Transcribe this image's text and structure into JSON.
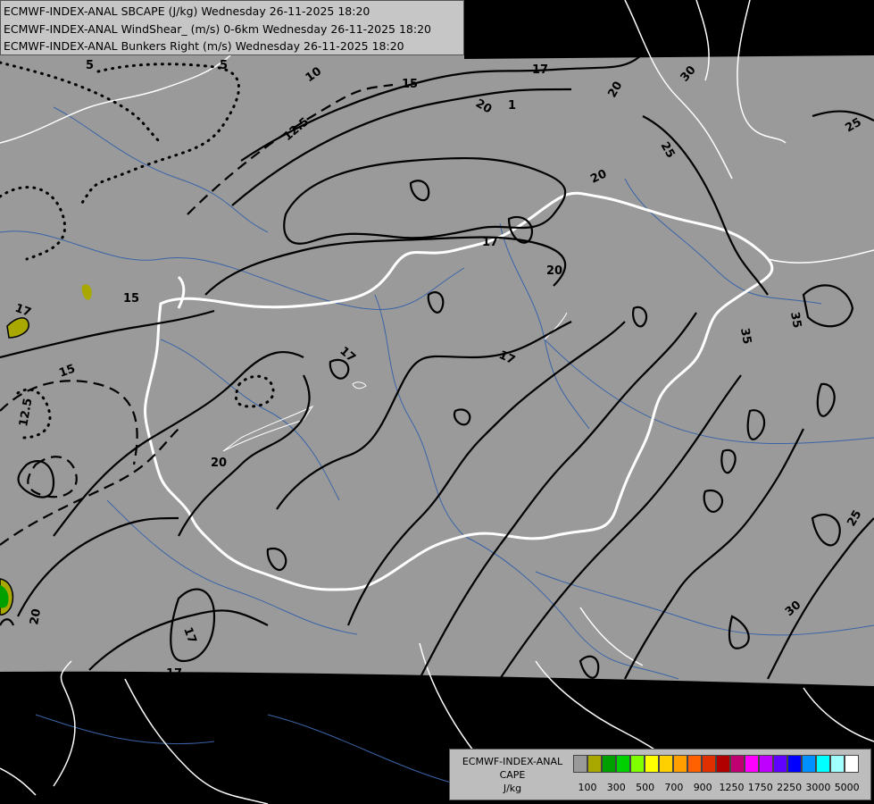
{
  "title": {
    "line1": "ECMWF-INDEX-ANAL SBCAPE (J/kg) Wednesday 26-11-2025 18:20",
    "line2": "ECMWF-INDEX-ANAL WindShear_ (m/s) 0-6km Wednesday 26-11-2025 18:20",
    "line3": "ECMWF-INDEX-ANAL Bunkers Right (m/s) Wednesday 26-11-2025 18:20"
  },
  "legend": {
    "line1": "ECMWF-INDEX-ANAL",
    "line2": "CAPE",
    "line3": "J/kg",
    "colors": [
      "#9a9a9a",
      "#a8a800",
      "#00a000",
      "#00d000",
      "#80ff00",
      "#ffff00",
      "#ffd000",
      "#ffa000",
      "#ff6000",
      "#e03000",
      "#b00000",
      "#c00070",
      "#ff00ff",
      "#c000ff",
      "#6000ff",
      "#0000ff",
      "#0090ff",
      "#00ffff",
      "#a0ffff",
      "#ffffff"
    ],
    "ticks": [
      "100",
      "300",
      "500",
      "700",
      "900",
      "1250",
      "1750",
      "2250",
      "3000",
      "5000"
    ]
  },
  "contour_labels": [
    "5",
    "5",
    "10",
    "12.5",
    "15",
    "20",
    "1",
    "17",
    "20",
    "25",
    "30",
    "25",
    "15",
    "17",
    "20",
    "17",
    "17",
    "15",
    "12.5",
    "20",
    "17",
    "20",
    "17",
    "20",
    "25",
    "35",
    "35",
    "30"
  ],
  "colors": {
    "background": "#000000",
    "domain": "#9a9a9a",
    "borders": "#ffffff",
    "rivers": "#3a64a8",
    "contours": "#000000"
  }
}
